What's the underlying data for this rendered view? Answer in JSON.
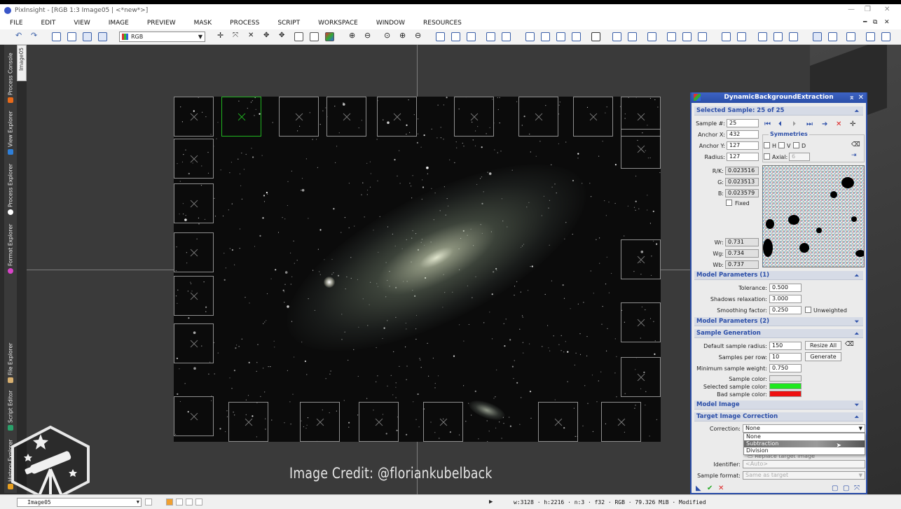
{
  "window": {
    "title": "PixInsight - [RGB 1:3 Image05 | <*new*>]",
    "app_icon": "pixinsight-icon"
  },
  "menu": [
    "FILE",
    "EDIT",
    "VIEW",
    "IMAGE",
    "PREVIEW",
    "MASK",
    "PROCESS",
    "SCRIPT",
    "WORKSPACE",
    "WINDOW",
    "RESOURCES"
  ],
  "toolbar": {
    "channel_select": "RGB"
  },
  "left_tabs": [
    {
      "label": "Process Console",
      "color": "#e86a1a"
    },
    {
      "label": "View Explorer",
      "color": "#2f7fd8"
    },
    {
      "label": "Process Explorer",
      "color": "#ffffff"
    },
    {
      "label": "Format Explorer",
      "color": "#d844c8"
    },
    {
      "label": "File Explorer",
      "color": "#d8b070"
    },
    {
      "label": "Script Editor",
      "color": "#2aa06a"
    },
    {
      "label": "History Explorer",
      "color": "#e8a020"
    }
  ],
  "image_tab": "Image05",
  "overlay": {
    "credit": "Image Credit: @floriankubelback"
  },
  "statusbar": {
    "view": "Image05",
    "info": "w:3128 · h:2216 · n:3 · f32 · RGB · 79.326 MiB · Modified"
  },
  "dbe": {
    "title": "DynamicBackgroundExtraction",
    "selected_sample": {
      "header": "Selected Sample: 25 of 25",
      "sample_num_label": "Sample #:",
      "sample_num": "25",
      "anchor_x_label": "Anchor X:",
      "anchor_x": "432",
      "anchor_y_label": "Anchor Y:",
      "anchor_y": "127",
      "radius_label": "Radius:",
      "radius": "127",
      "rk_label": "R/K:",
      "rk": "0.023516",
      "g_label": "G:",
      "g": "0.023513",
      "b_label": "B:",
      "b": "0.023579",
      "fixed_label": "Fixed",
      "wr_label": "Wr:",
      "wr": "0.731",
      "wg_label": "Wg:",
      "wg": "0.734",
      "wb_label": "Wb:",
      "wb": "0.737",
      "symmetries": "Symmetries",
      "sym_h": "H",
      "sym_v": "V",
      "sym_d": "D",
      "axial_label": "Axial:",
      "axial": "6"
    },
    "model_params_1": {
      "header": "Model Parameters (1)",
      "tolerance_label": "Tolerance:",
      "tolerance": "0.500",
      "shadows_label": "Shadows relaxation:",
      "shadows": "3.000",
      "smoothing_label": "Smoothing factor:",
      "smoothing": "0.250",
      "unweighted": "Unweighted"
    },
    "model_params_2": {
      "header": "Model Parameters (2)"
    },
    "sample_generation": {
      "header": "Sample Generation",
      "default_radius_label": "Default sample radius:",
      "default_radius": "150",
      "resize_all": "Resize All",
      "per_row_label": "Samples per row:",
      "per_row": "10",
      "generate": "Generate",
      "min_weight_label": "Minimum sample weight:",
      "min_weight": "0.750",
      "sample_color_label": "Sample color:",
      "sample_color": "#e6e6e6",
      "selected_color_label": "Selected sample color:",
      "selected_color": "#1ee81e",
      "bad_color_label": "Bad sample color:",
      "bad_color": "#ee1010"
    },
    "model_image": {
      "header": "Model Image"
    },
    "target_correction": {
      "header": "Target Image Correction",
      "correction_label": "Correction:",
      "correction": "None",
      "options": [
        "None",
        "Subtraction",
        "Division"
      ],
      "replace_label": "Replace target image",
      "identifier_label": "Identifier:",
      "identifier": "<Auto>",
      "sample_format_label": "Sample format:",
      "sample_format": "Same as target"
    }
  }
}
